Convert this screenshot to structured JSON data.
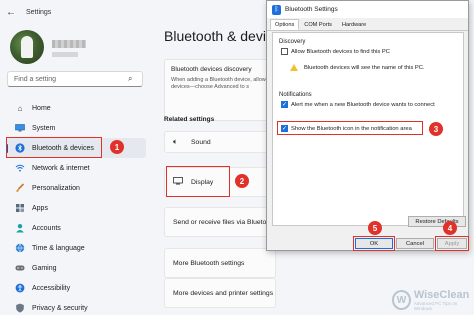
{
  "app": {
    "title": "Settings",
    "back_icon": "arrow-left-icon"
  },
  "search": {
    "placeholder": "Find a setting"
  },
  "nav": [
    {
      "label": "Home",
      "icon": "home-icon"
    },
    {
      "label": "System",
      "icon": "monitor-icon"
    },
    {
      "label": "Bluetooth & devices",
      "icon": "bluetooth-icon"
    },
    {
      "label": "Network & internet",
      "icon": "wifi-icon"
    },
    {
      "label": "Personalization",
      "icon": "brush-icon"
    },
    {
      "label": "Apps",
      "icon": "apps-icon"
    },
    {
      "label": "Accounts",
      "icon": "person-icon"
    },
    {
      "label": "Time & language",
      "icon": "globe-icon"
    },
    {
      "label": "Gaming",
      "icon": "gamepad-icon"
    },
    {
      "label": "Accessibility",
      "icon": "accessibility-icon"
    },
    {
      "label": "Privacy & security",
      "icon": "shield-icon"
    }
  ],
  "main": {
    "title": "Bluetooth & devic",
    "discovery": {
      "title": "Bluetooth devices discovery",
      "desc": "When adding a Bluetooth device, allow\ndevices—choose Advanced to s"
    },
    "related_label": "Related settings",
    "rows": [
      {
        "label": "Sound",
        "icon": "speaker-icon"
      },
      {
        "label": "Display",
        "icon": "display-icon"
      },
      {
        "label": "Send or receive files via Blueto",
        "icon": ""
      },
      {
        "label": "More Bluetooth settings",
        "icon": ""
      },
      {
        "label": "More devices and printer settings",
        "icon": ""
      }
    ]
  },
  "dialog": {
    "title": "Bluetooth Settings",
    "tabs": [
      "Options",
      "COM Ports",
      "Hardware"
    ],
    "discovery_label": "Discovery",
    "allow_discovery": "Allow Bluetooth devices to find this PC",
    "warning": "Bluetooth devices will see the name of this PC.",
    "notifications_label": "Notifications",
    "alert_new": "Alert me when a new Bluetooth device wants to connect",
    "show_icon": "Show the Bluetooth icon in the notification area",
    "restore": "Restore Defaults",
    "ok": "OK",
    "cancel": "Cancel",
    "apply": "Apply"
  },
  "badges": [
    "1",
    "2",
    "3",
    "4",
    "5"
  ],
  "watermark": {
    "name": "WiseClean",
    "tag": "Advanced PC Tips on Windows"
  },
  "colors": {
    "accent": "#005fb8",
    "highlight": "#e0322b",
    "bt_blue": "#1e6fd9"
  }
}
